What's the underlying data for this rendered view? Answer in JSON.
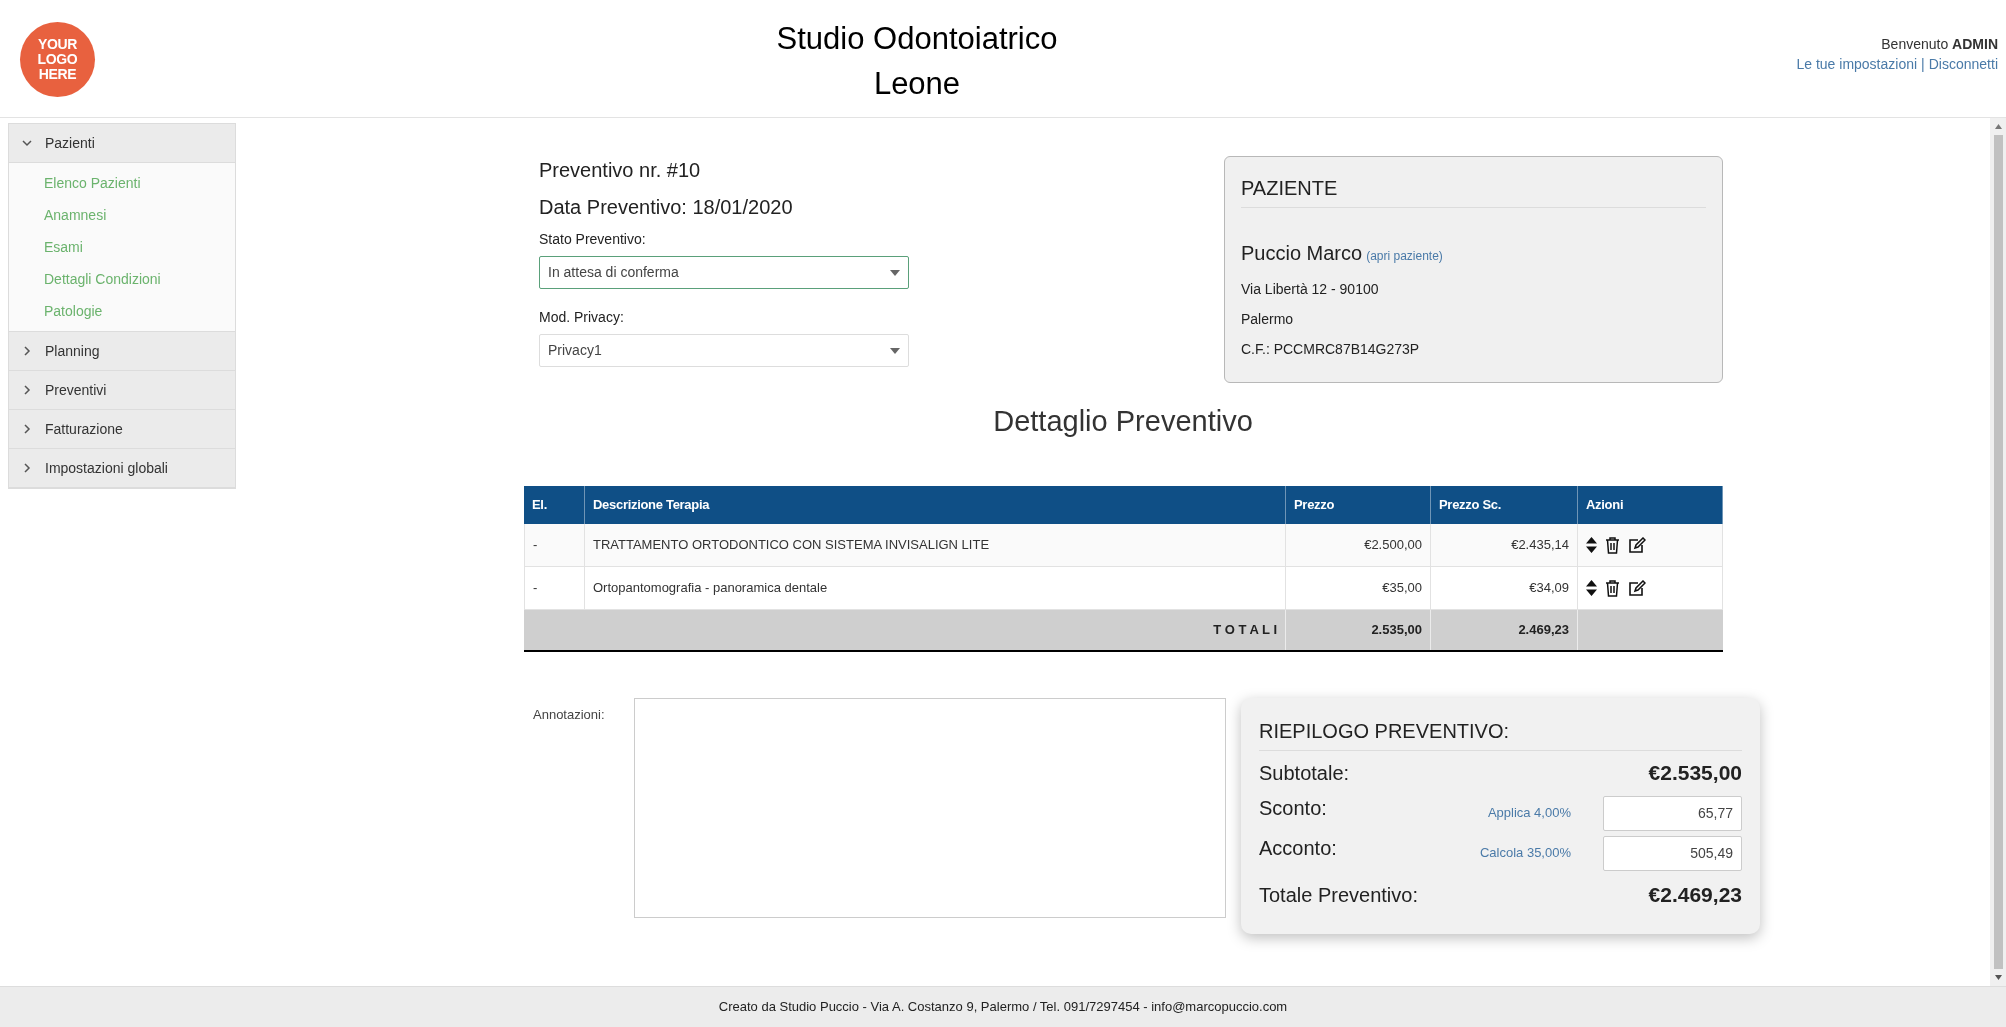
{
  "header": {
    "logo_text": [
      "YOUR",
      "LOGO",
      "HERE"
    ],
    "title_lines": [
      "Studio Odontoiatrico",
      "Leone"
    ],
    "welcome": "Benvenuto",
    "user": "ADMIN",
    "links": [
      "Le tue impostazioni",
      "Disconnetti"
    ],
    "link_separator": "|"
  },
  "sidebar": {
    "groups": [
      {
        "label": "Pazienti",
        "expanded": true,
        "children": [
          {
            "label": "Elenco Pazienti"
          },
          {
            "label": "Anamnesi"
          },
          {
            "label": "Esami"
          },
          {
            "label": "Dettagli Condizioni"
          },
          {
            "label": "Patologie"
          }
        ]
      },
      {
        "label": "Planning",
        "expanded": false
      },
      {
        "label": "Preventivi",
        "expanded": false
      },
      {
        "label": "Fatturazione",
        "expanded": false
      },
      {
        "label": "Impostazioni globali",
        "expanded": false
      }
    ]
  },
  "quote": {
    "number": "Preventivo nr. #10",
    "date": "Data Preventivo: 18/01/2020",
    "fields": [
      {
        "label": "Stato Preventivo:",
        "value": "In attesa di conferma",
        "focused": true
      },
      {
        "label": "Mod. Privacy:",
        "value": "Privacy1",
        "focused": false
      }
    ]
  },
  "patient": {
    "heading": "PAZIENTE",
    "name": "Puccio Marco",
    "link": "(apri paziente)",
    "lines": [
      "Via Libertà 12 - 90100",
      "Palermo",
      "C.F.: PCCMRC87B14G273P"
    ]
  },
  "section_title": "Dettaglio Preventivo",
  "table": {
    "columns": [
      "El.",
      "Descrizione Terapia",
      "Prezzo",
      "Prezzo Sc.",
      "Azioni"
    ],
    "rows": [
      {
        "el": "-",
        "description": "TRATTAMENTO ORTODONTICO CON SISTEMA INVISALIGN LITE",
        "price": "€2.500,00",
        "discounted": "€2.435,14"
      },
      {
        "el": "-",
        "description": "Ortopantomografia - panoramica dentale",
        "price": "€35,00",
        "discounted": "€34,09"
      }
    ],
    "totals": {
      "label": "T O T A L I",
      "price": "2.535,00",
      "discounted": "2.469,23"
    }
  },
  "notes": {
    "label": "Annotazioni:"
  },
  "summary": {
    "heading": "RIEPILOGO PREVENTIVO:",
    "rows": [
      {
        "kind": "total",
        "label": "Subtotale:",
        "value": "€2.535,00"
      },
      {
        "kind": "input",
        "label": "Sconto:",
        "action": "Applica 4,00%",
        "value": "65,77"
      },
      {
        "kind": "input",
        "label": "Acconto:",
        "action": "Calcola 35,00%",
        "value": "505,49"
      },
      {
        "kind": "total",
        "label": "Totale Preventivo:",
        "value": "€2.469,23"
      }
    ]
  },
  "footer": "Creato da Studio Puccio - Via A. Costanzo 9, Palermo / Tel. 091/7297454 - info@marcopuccio.com"
}
